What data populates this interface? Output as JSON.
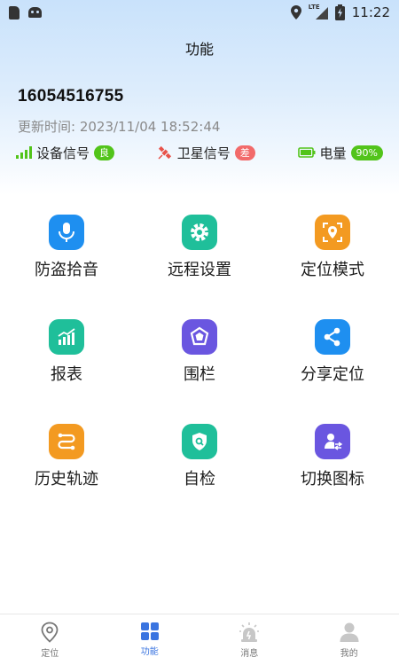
{
  "status_bar": {
    "time": "11:22",
    "network": "LTE"
  },
  "header": {
    "title": "功能"
  },
  "device": {
    "number": "16054516755",
    "update_time": "更新时间: 2023/11/04 18:52:44"
  },
  "signals": {
    "device_signal_label": "设备信号",
    "device_signal_badge": "良",
    "satellite_signal_label": "卫星信号",
    "satellite_signal_badge": "差",
    "battery_label": "电量",
    "battery_badge": "90%"
  },
  "functions": [
    {
      "label": "防盗拾音",
      "icon": "microphone-icon",
      "color": "#1e8ff0"
    },
    {
      "label": "远程设置",
      "icon": "gear-icon",
      "color": "#1fbf9a"
    },
    {
      "label": "定位模式",
      "icon": "location-frame-icon",
      "color": "#f39a21"
    },
    {
      "label": "报表",
      "icon": "report-chart-icon",
      "color": "#1fbf9a"
    },
    {
      "label": "围栏",
      "icon": "fence-polygon-icon",
      "color": "#6a56e0"
    },
    {
      "label": "分享定位",
      "icon": "share-icon",
      "color": "#1e8ff0"
    },
    {
      "label": "历史轨迹",
      "icon": "route-icon",
      "color": "#f39a21"
    },
    {
      "label": "自检",
      "icon": "self-check-shield-icon",
      "color": "#1fbf9a"
    },
    {
      "label": "切换图标",
      "icon": "switch-user-icon",
      "color": "#6a56e0"
    }
  ],
  "tabs": [
    {
      "label": "定位",
      "icon": "location-pin-icon",
      "active": false
    },
    {
      "label": "功能",
      "icon": "grid-icon",
      "active": true
    },
    {
      "label": "消息",
      "icon": "alarm-icon",
      "active": false
    },
    {
      "label": "我的",
      "icon": "person-icon",
      "active": false
    }
  ],
  "colors": {
    "accent": "#3a74e0",
    "good": "#52c41a",
    "bad": "#f26a6a"
  }
}
